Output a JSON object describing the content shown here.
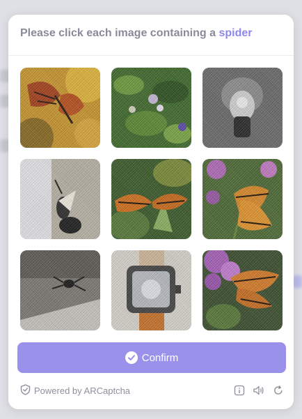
{
  "prompt": {
    "text": "Please click each image containing a ",
    "keyword": "spider"
  },
  "tiles": [
    {
      "subject": "butterfly on orange flowers"
    },
    {
      "subject": "green foliage with flowers"
    },
    {
      "subject": "grey object close-up"
    },
    {
      "subject": "insect on wall"
    },
    {
      "subject": "monarch butterfly on plant"
    },
    {
      "subject": "monarch butterfly on purple flowers"
    },
    {
      "subject": "spider on floor"
    },
    {
      "subject": "wrist watch"
    },
    {
      "subject": "monarch butterfly on lilac"
    }
  ],
  "confirm_label": "Confirm",
  "footer": {
    "powered_by": "Powered by ARCaptcha",
    "icons": [
      "shield-icon",
      "info-icon",
      "audio-icon",
      "refresh-icon"
    ]
  },
  "colors": {
    "accent": "#8d88ea",
    "button": "#9a91ea",
    "prompt_text": "#8a8b9a"
  }
}
